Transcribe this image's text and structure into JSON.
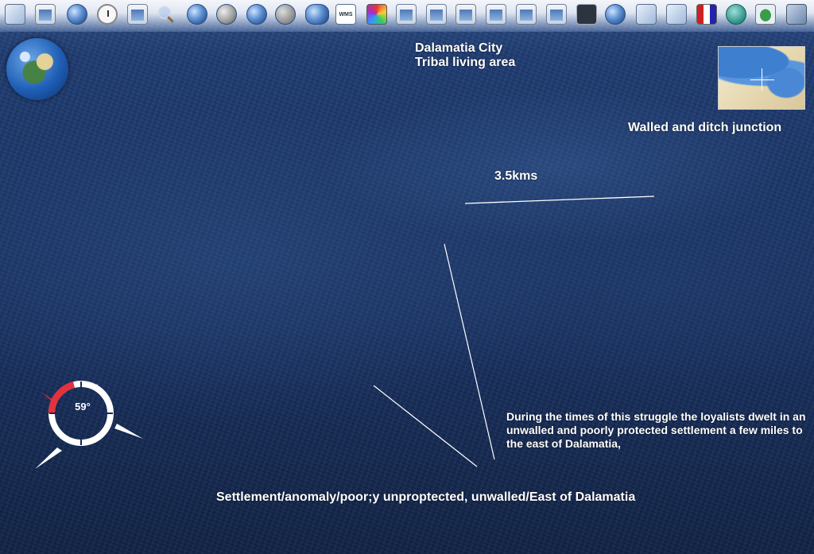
{
  "window": {
    "background_color": "#17305a",
    "accent_red": "#e8303a"
  },
  "toolbar": {
    "items": [
      {
        "icon": "layers-icon"
      },
      {
        "icon": "grid-icon"
      },
      {
        "icon": "globe-view-icon"
      },
      {
        "icon": "clock-icon"
      },
      {
        "icon": "bookmark-icon"
      },
      {
        "icon": "search-icon"
      },
      {
        "icon": "earth-icon"
      },
      {
        "icon": "moon-icon"
      },
      {
        "icon": "placemark-globe-icon"
      },
      {
        "icon": "add-layer-icon"
      },
      {
        "icon": "blue-marble-icon"
      },
      {
        "icon": "wms-icon",
        "label": "WMS"
      },
      {
        "icon": "color-map-icon"
      },
      {
        "icon": "satellite-layer-icon"
      },
      {
        "icon": "landsat-layer-icon"
      },
      {
        "icon": "usgs-layer-icon"
      },
      {
        "icon": "terrain-layer-icon"
      },
      {
        "icon": "geocover-layer-icon"
      },
      {
        "icon": "topo-layer-icon"
      },
      {
        "icon": "dark-layer-icon"
      },
      {
        "icon": "world-globe-icon"
      },
      {
        "icon": "satellite-map-icon"
      },
      {
        "icon": "animated-layer-icon"
      },
      {
        "icon": "country-flags-icon"
      },
      {
        "icon": "landmarks-icon"
      },
      {
        "icon": "us-map-icon"
      },
      {
        "icon": "scale-bar-icon"
      }
    ]
  },
  "annotations": {
    "title_line1": "Dalamatia City",
    "title_line2": "Tribal living area",
    "junction": "Walled and ditch junction",
    "distance": "3.5kms",
    "loyalists": "During the times of this struggle the loyalists dwelt in an unwalled and poorly protected settlement a few miles to the east of Dalamatia,",
    "settlement": "Settlement/anomaly/poor;y unproptected, unwalled/East of Dalamatia"
  },
  "compass": {
    "heading_label": "59°",
    "heading_degrees": 59
  }
}
